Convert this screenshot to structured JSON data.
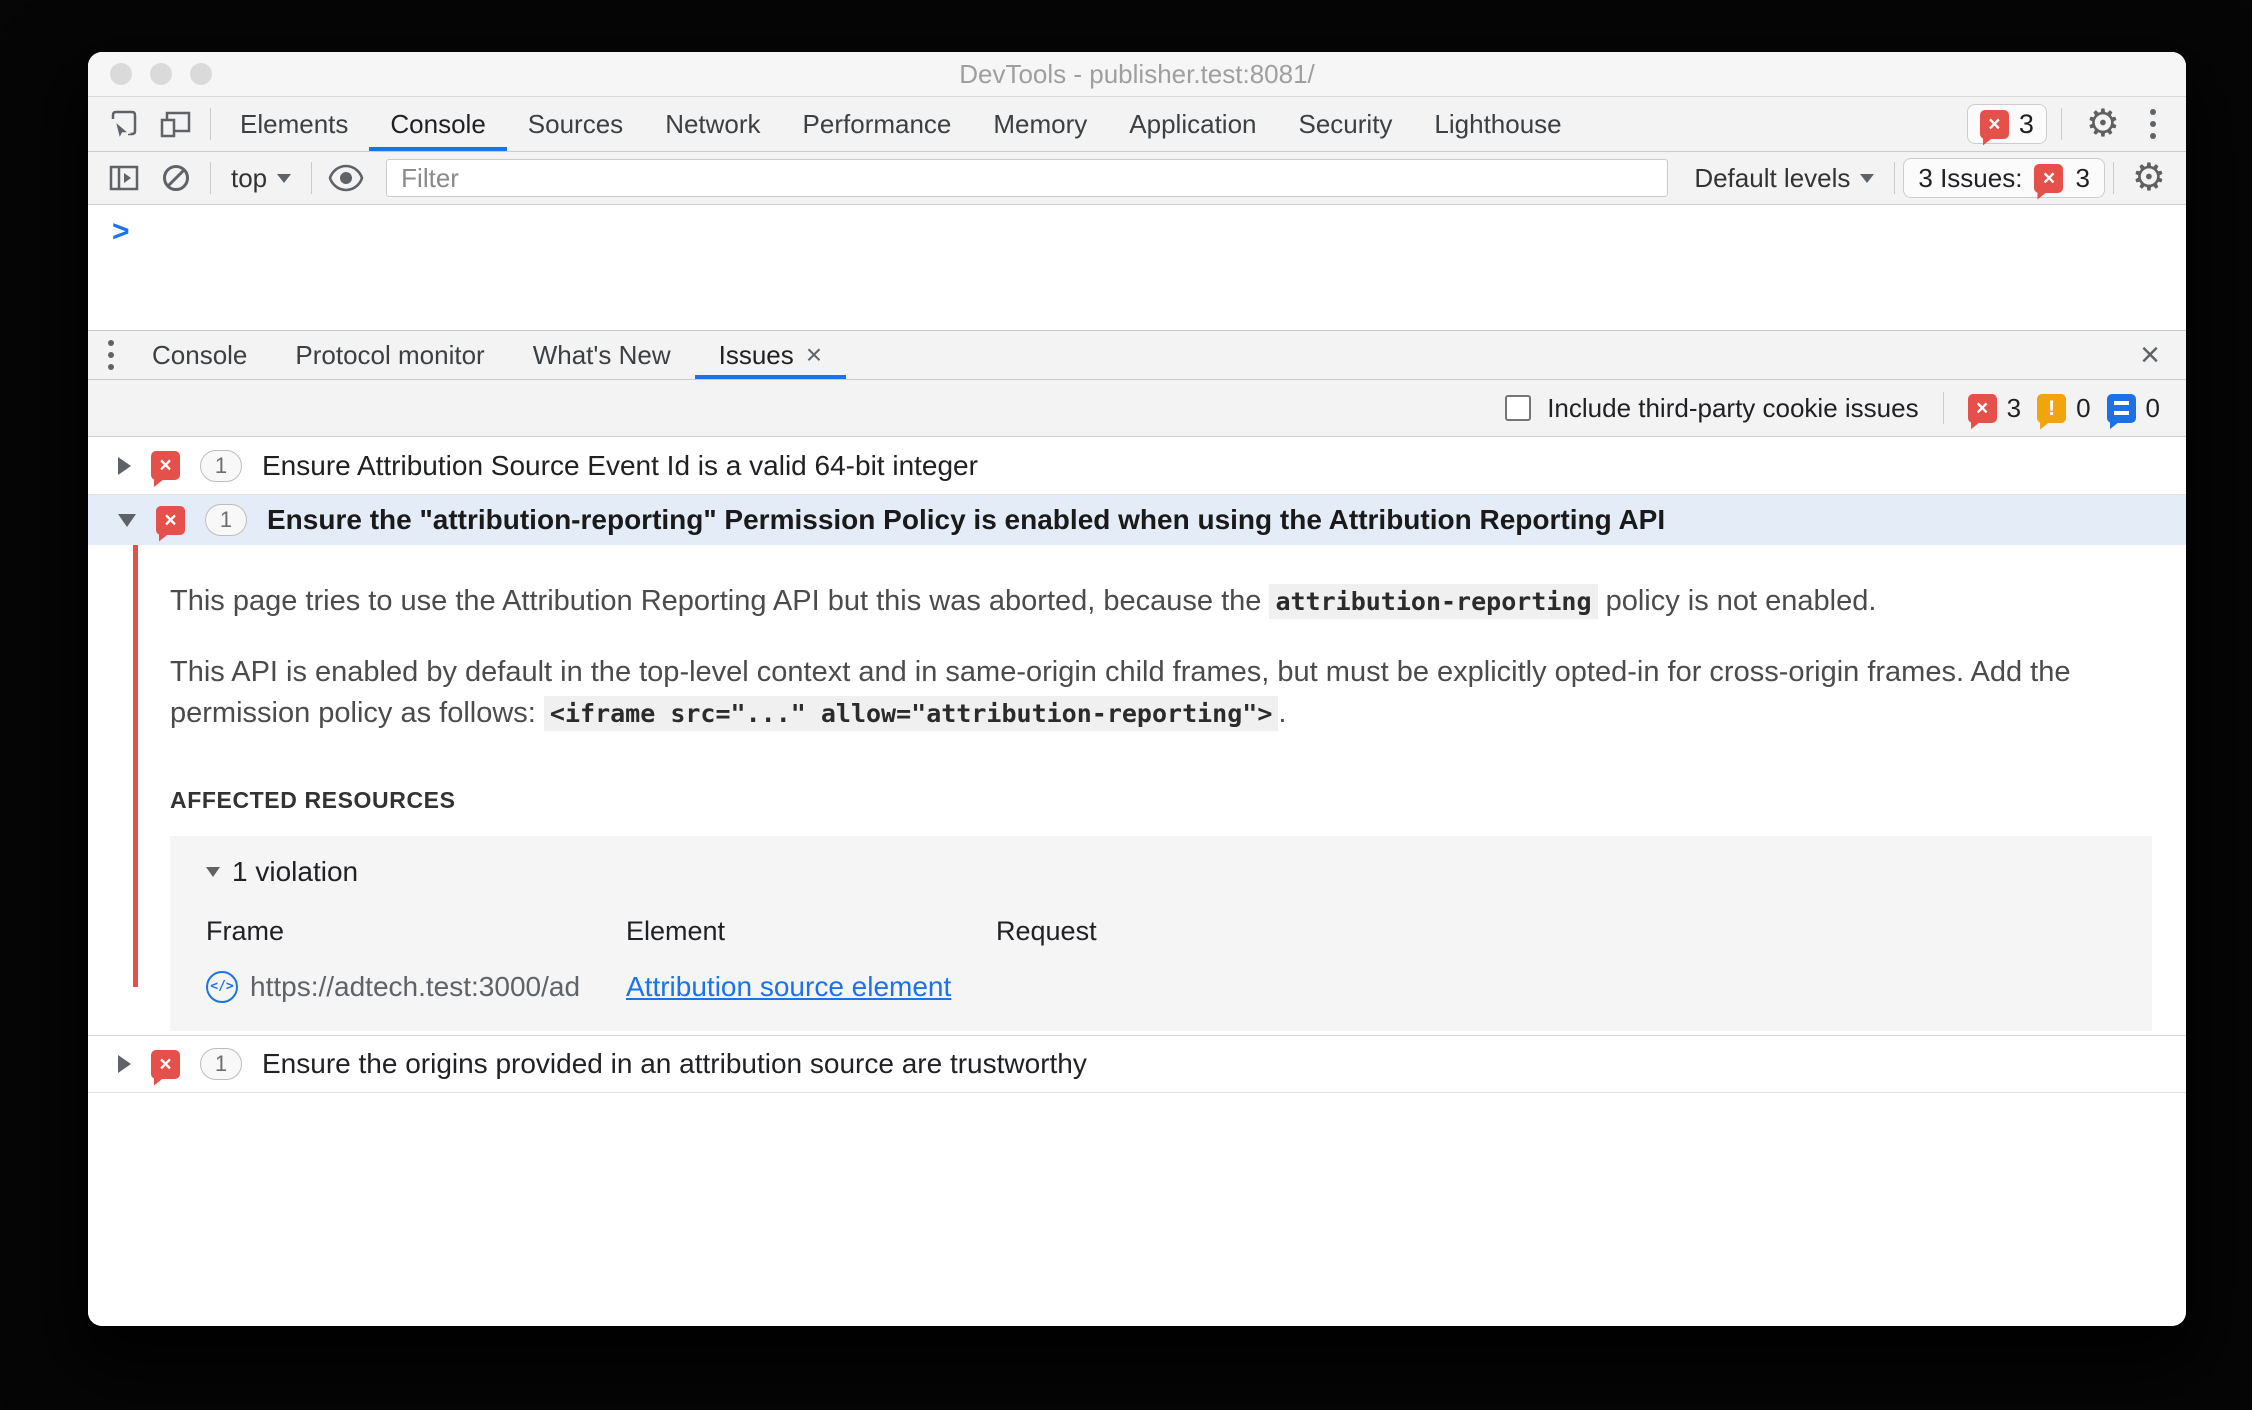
{
  "window": {
    "title": "DevTools - publisher.test:8081/"
  },
  "main_tabs": {
    "items": [
      "Elements",
      "Console",
      "Sources",
      "Network",
      "Performance",
      "Memory",
      "Application",
      "Security",
      "Lighthouse"
    ],
    "active": "Console",
    "error_badge_count": "3"
  },
  "console_toolbar": {
    "context_selector": "top",
    "filter_placeholder": "Filter",
    "levels_label": "Default levels",
    "issues_label": "3 Issues:",
    "issues_count": "3"
  },
  "console": {
    "prompt": ">"
  },
  "drawer_tabs": {
    "items": [
      "Console",
      "Protocol monitor",
      "What's New",
      "Issues"
    ],
    "active": "Issues"
  },
  "issues_toolbar": {
    "checkbox_label": "Include third-party cookie issues",
    "error_count": "3",
    "warning_count": "0",
    "message_count": "0"
  },
  "issues": {
    "row1": {
      "count": "1",
      "title": "Ensure Attribution Source Event Id is a valid 64-bit integer"
    },
    "row2": {
      "count": "1",
      "title": "Ensure the \"attribution-reporting\" Permission Policy is enabled when using the Attribution Reporting API"
    },
    "row3": {
      "count": "1",
      "title": "Ensure the origins provided in an attribution source are trustworthy"
    }
  },
  "issue_detail": {
    "p1_before": "This page tries to use the Attribution Reporting API but this was aborted, because the ",
    "p1_code": "attribution-reporting",
    "p1_after": " policy is not enabled.",
    "p2_before": "This API is enabled by default in the top-level context and in same-origin child frames, but must be explicitly opted-in for cross-origin frames. Add the permission policy as follows: ",
    "p2_code": "<iframe src=\"...\" allow=\"attribution-reporting\">",
    "p2_after": ".",
    "affected_heading": "AFFECTED RESOURCES",
    "violation_label": "1 violation",
    "table": {
      "headers": [
        "Frame",
        "Element",
        "Request"
      ],
      "row": {
        "frame_url": "https://adtech.test:3000/ad",
        "element_link": "Attribution source element",
        "request": ""
      }
    }
  },
  "icons": {
    "gear": "⚙",
    "close": "×",
    "error_x": "×",
    "warning_mark": "!",
    "frame_code": "</>"
  },
  "colors": {
    "accent_blue": "#1a73e8",
    "error_red": "#e5504a",
    "warning_yellow": "#f2a40d",
    "message_blue": "#1f6fe5"
  }
}
